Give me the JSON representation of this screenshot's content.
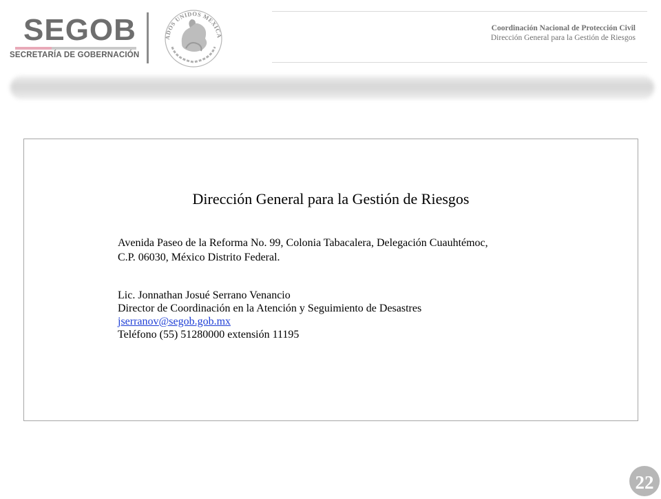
{
  "header": {
    "logo_text": "SEGOB",
    "logo_subtitle": "SECRETARÍA DE GOBERNACIÓN",
    "seal_text": "ESTADOS UNIDOS MEXICANOS",
    "org_name": "Coordinación Nacional de Protección Civil",
    "org_sub": "Dirección General para la Gestión de Riesgos",
    "colors": {
      "logo_gray": "#6e6e6e",
      "accent_pink": "#e8a9b8"
    }
  },
  "content": {
    "title": "Dirección General para la Gestión de Riesgos",
    "address_line1": "Avenida Paseo de la Reforma No. 99, Colonia Tabacalera, Delegación Cuauhtémoc,",
    "address_line2": "C.P. 06030,  México Distrito Federal.",
    "contact_name": "Lic. Jonnathan Josué Serrano Venancio",
    "contact_role": "Director de Coordinación en la Atención y Seguimiento de Desastres",
    "contact_email": "jserranov@segob.gob.mx",
    "contact_phone": "Teléfono (55) 51280000 extensión 11195"
  },
  "page_number": "22"
}
